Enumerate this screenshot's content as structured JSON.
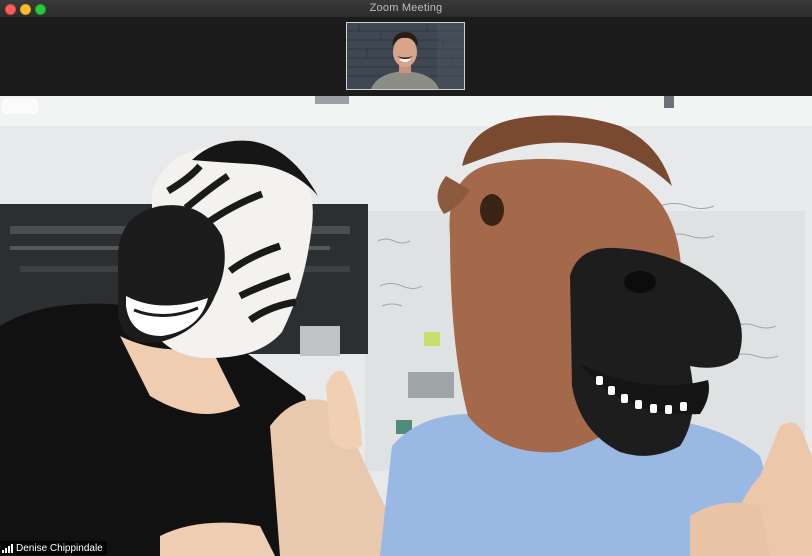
{
  "window": {
    "title": "Zoom Meeting",
    "controls": [
      "close",
      "minimize",
      "zoom"
    ]
  },
  "thumbnail_participant": {
    "video": "video-thumbnail"
  },
  "main_participant": {
    "name": "Denise Chippindale",
    "connection_icon": "signal-bars-icon"
  },
  "colors": {
    "titlebar": "#2e2e2e",
    "strip": "#1c1c1c",
    "close": "#ff5f57",
    "minimize": "#febc2e",
    "zoom": "#28c840"
  }
}
